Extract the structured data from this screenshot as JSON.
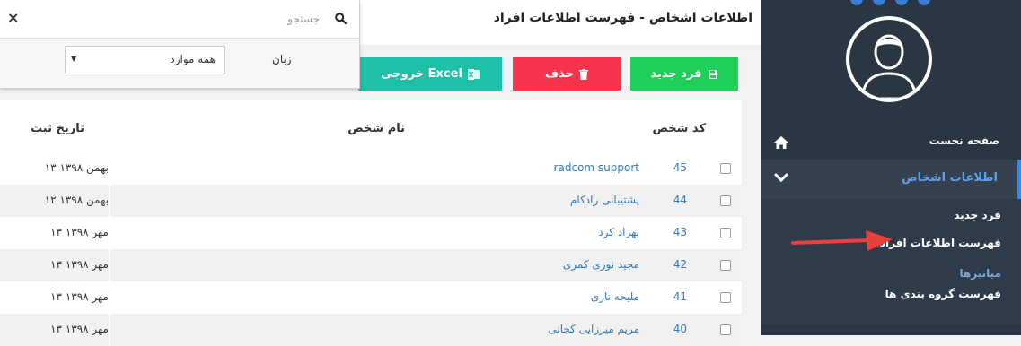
{
  "page": {
    "title": "اطلاعات اشخاص - فهرست اطلاعات افراد"
  },
  "toolbar": {
    "new_label": "فرد جدید",
    "delete_label": "حذف",
    "excel_label": "خروجی Excel"
  },
  "search": {
    "placeholder": "جستجو",
    "value": "",
    "language_label": "زبان",
    "language_selected": "همه موارد",
    "close_symbol": "×"
  },
  "table": {
    "columns": [
      "کد شخص",
      "نام شخص",
      "تاریخ ثبت"
    ],
    "rows": [
      {
        "code": "45",
        "name": "radcom support",
        "date": "۱۳ بهمن ۱۳۹۸"
      },
      {
        "code": "44",
        "name": "پشتیبانی رادکام",
        "date": "۱۲ بهمن ۱۳۹۸"
      },
      {
        "code": "43",
        "name": "بهزاد کرد",
        "date": "۱۳ مهر ۱۳۹۸"
      },
      {
        "code": "42",
        "name": "مجید نوری کمری",
        "date": "۱۳ مهر ۱۳۹۸"
      },
      {
        "code": "41",
        "name": "ملیحه نازی",
        "date": "۱۳ مهر ۱۳۹۸"
      },
      {
        "code": "40",
        "name": "مریم میرزایی کجانی",
        "date": "۱۳ مهر ۱۳۹۸"
      }
    ]
  },
  "sidebar": {
    "home_label": "صفحه نخست",
    "section_label": "اطلاعات اشخاص",
    "sub_items": [
      "فرد جدید",
      "فهرست اطلاعات افراد"
    ],
    "group_heading": "میانبرها",
    "group_item": "فهرست گروه بندی ها"
  },
  "colors": {
    "sidebar_bg": "#2b3643",
    "new_button": "#1fcf5a",
    "delete_button": "#f5354c",
    "excel_button": "#1fbfa8",
    "link": "#337ab7",
    "annotation_arrow": "#e8403a"
  },
  "icons": {
    "new_button_icon": "save-icon",
    "delete_button_icon": "trash-icon",
    "excel_button_icon": "excel-icon",
    "search_icon": "search-icon",
    "home_icon": "home-icon",
    "section_icon": "chevron-down-icon",
    "avatar": "user-avatar-icon"
  }
}
